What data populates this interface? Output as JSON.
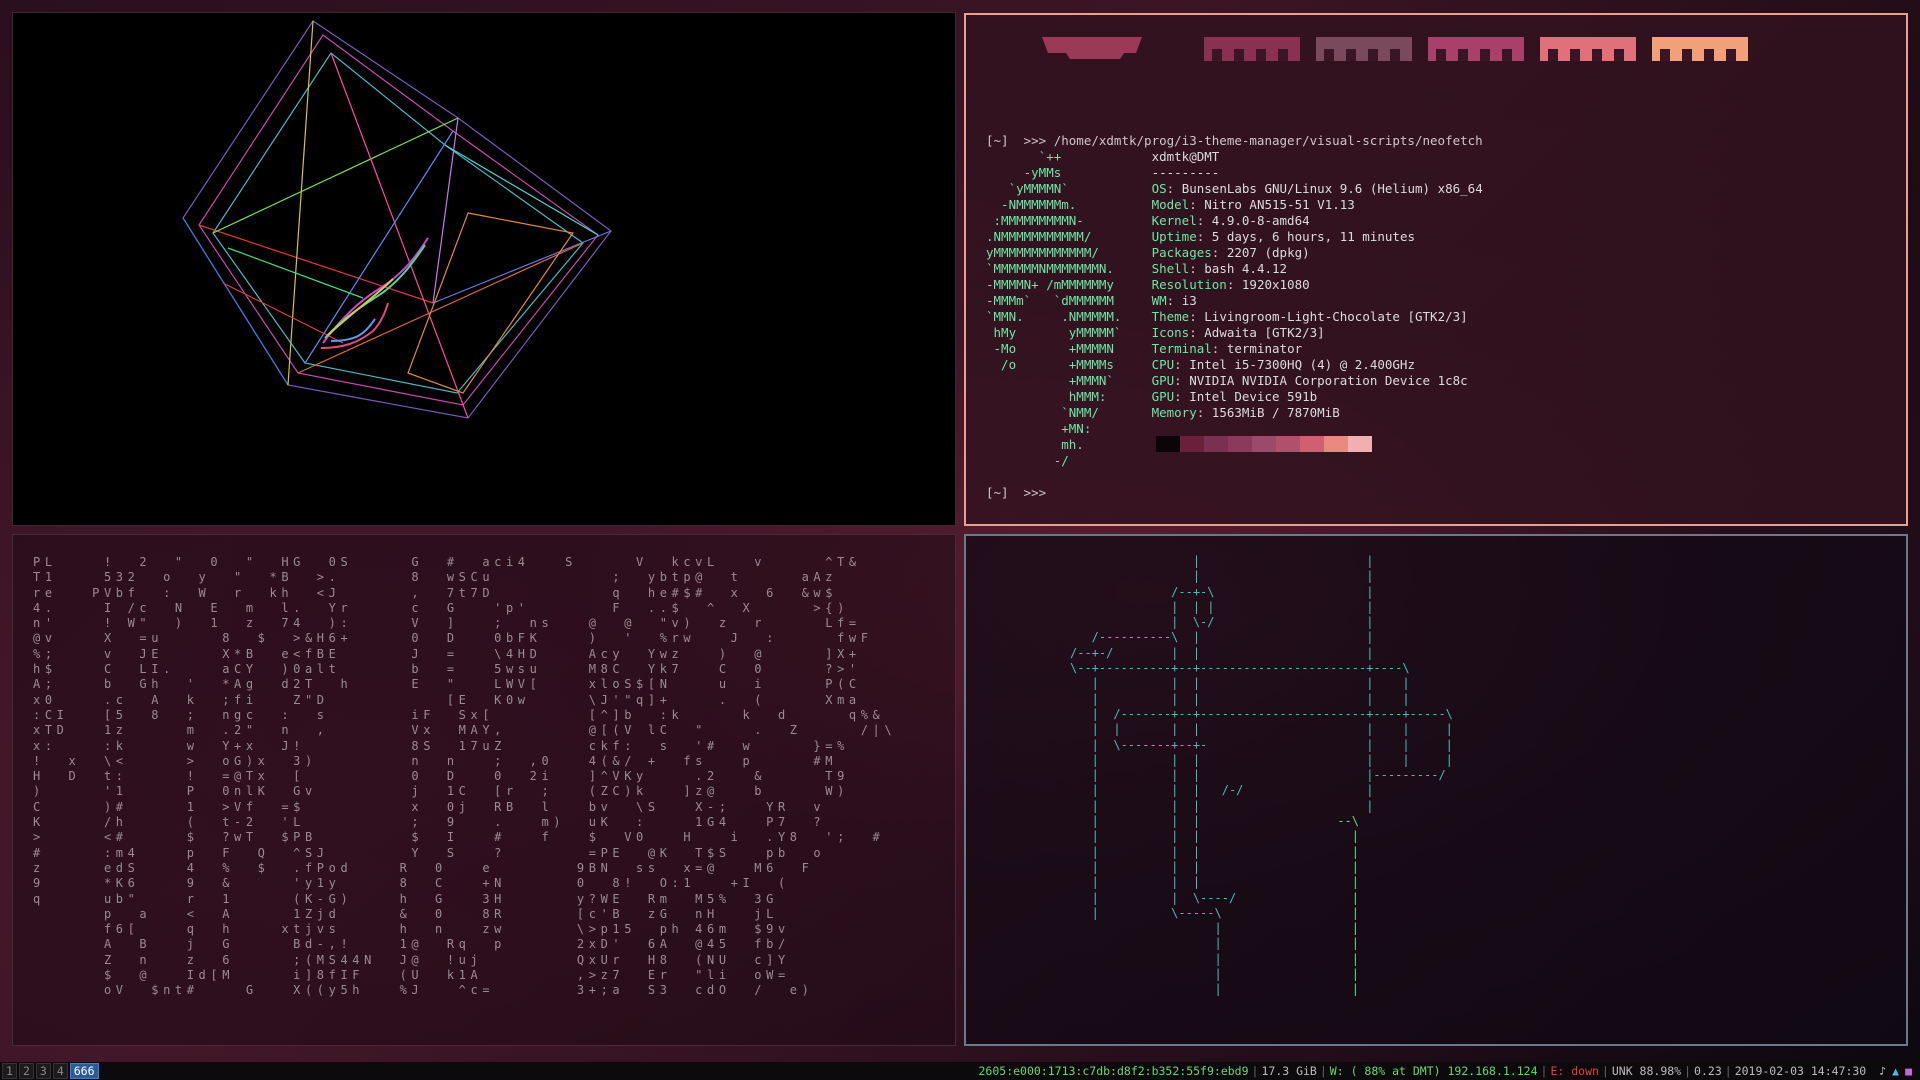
{
  "workspaces": [
    {
      "label": "1",
      "active": false
    },
    {
      "label": "2",
      "active": false
    },
    {
      "label": "3",
      "active": false
    },
    {
      "label": "4",
      "active": false
    },
    {
      "label": "666",
      "active": true
    }
  ],
  "neofetch": {
    "prompt_cmd": "[~]  >>> /home/xdmtk/prog/i3-theme-manager/visual-scripts/neofetch",
    "userhost": "xdmtk@DMT",
    "divider": "---------",
    "fields": [
      {
        "key": "OS",
        "value": "BunsenLabs GNU/Linux 9.6 (Helium) x86_64"
      },
      {
        "key": "Model",
        "value": "Nitro AN515-51 V1.13"
      },
      {
        "key": "Kernel",
        "value": "4.9.0-8-amd64"
      },
      {
        "key": "Uptime",
        "value": "5 days, 6 hours, 11 minutes"
      },
      {
        "key": "Packages",
        "value": "2207 (dpkg)"
      },
      {
        "key": "Shell",
        "value": "bash 4.4.12"
      },
      {
        "key": "Resolution",
        "value": "1920x1080"
      },
      {
        "key": "WM",
        "value": "i3"
      },
      {
        "key": "Theme",
        "value": "Livingroom-Light-Chocolate [GTK2/3]"
      },
      {
        "key": "Icons",
        "value": "Adwaita [GTK2/3]"
      },
      {
        "key": "Terminal",
        "value": "terminator"
      },
      {
        "key": "CPU",
        "value": "Intel i5-7300HQ (4) @ 2.400GHz"
      },
      {
        "key": "GPU",
        "value": "NVIDIA NVIDIA Corporation Device 1c8c"
      },
      {
        "key": "GPU",
        "value": "Intel Device 591b"
      },
      {
        "key": "Memory",
        "value": "1563MiB / 7870MiB"
      }
    ],
    "logo": [
      "       `++",
      "     -yMMs",
      "   `yMMMMN`",
      "  -NMMMMMMm.",
      " :MMMMMMMMMN-",
      ".NMMMMMMMMMMM/",
      "yMMMMMMMMMMMMM/",
      "`MMMMMMNMMMMMMMN.",
      "-MMMMN+ /mMMMMMMy",
      "-MMMm`   `dMMMMMM",
      "`MMN.     .NMMMMM.",
      " hMy       yMMMMM`",
      " -Mo       +MMMMN",
      "  /o       +MMMMs",
      "           +MMMN`",
      "           hMMM:",
      "          `NMM/",
      "          +MN:",
      "          mh.",
      "         -/"
    ],
    "prompt_end": "[~]  >>>",
    "palette": [
      "#0b0508",
      "#6a1f3b",
      "#7a3050",
      "#8c3a5c",
      "#9c4a6a",
      "#b0506a",
      "#d06070",
      "#e88a80",
      "#f0b0b0"
    ],
    "header_blocks": [
      "#9a3a58",
      "#8a3050",
      "#7a4a5c",
      "#a8406a",
      "#e0707a",
      "#f2a07a"
    ]
  },
  "matrix_lines": [
    "PL    !  2  \"  0  \"  HG  0S     G  #  aci4   S     V  kcvL   v     ^T&",
    "T1    532  o  y  \"  *B  >.      8  wSCu          ;  ybtp@  t     aAz",
    "re   PVbf  :  W  r  kh  <J      ,  7t7D          q  he#$#  x  6  &w$",
    "4.    I /c  N  E  m  l.  Yr     c  G   'p'       F  ..$  ^  X     >{)",
    "n'    ! W\"  )  1  z  74  ):     V  ]   ;  ns   @  @  \"v)  z  r     Lf=",
    "@v    X  =u     8  $  >&H6+     0  D   0bFK    )  '  %rw   J  :     fwF",
    "%;    v  JE     X*B  e<fBE      J  =   \\4HD    Acy  Ywz   )  @     ]X+",
    "h$    C  LI.    aCY  )0alt      b  =   5wsu    M8C  Yk7   C  0     ?>'",
    "A;    b  Gh  '  *Ag  d2T  h     E  \"   LWV[    xloS$[N    u  i     P(C",
    "x0    .c  A  k  ;fi   Z\"D          [E  K0w     \\J'\"q]+    .  (     Xma",
    ":CI   [5  8  ;  ngc  :  s       iF  Sx[        [^]b  :k     k  d     q%&",
    "xTD   1z     m  .2\"  n  ,       Vx  MAY,       @[(V lC  \"    .  Z     /|\\",
    "x:    :k     w  Y+x  J!         8S  17uZ       ckf:  s  '#  w     }=%",
    "!  x  \\<     >  oG)x  3)        n  n   ;  ,0   4(&/ +  fs   p     #M",
    "H  D  t:     !  =@Tx  [         0  D   0  2i   ]^VKy    .2   &     T9",
    ")     '1     P  0nlK  Gv        j  1C  [r  ;   (ZC)k   ]z@   b     W)",
    "C     )#     1  >Vf  =$         x  0j  RB  l   bv  \\S   X-;   YR  v",
    "K     /h     (  t-2  'L         ;  9   .   m)  uK  :    1G4   P7  ?",
    ">     <#     $  ?wT  $PB        $  I   #   f   $  V0   H   i  .Y8  ';  #",
    "#     :m4    p  F  Q  ^SJ       Y  S   ?       =PE  @K  T$S   pb  o",
    "z     edS    4  %  $  .fPod    R  0   e       9BN  ss  x=@   M6  F",
    "9     *K6    9  &     'y1y     8  C   +N      0  8!  O:1   +I  (",
    "q     ub\"    r  1     (K-G)    h  G   3H      y?WE  Rm  M5%  3G",
    "      p  a   <  A     1Zjd     &  0   8R      [c'B  zG  nH   jL",
    "      f6[    q  h    xtjvs     h  n   zw      \\>p15  ph 46m  $9v",
    "      A  B   j  G     Bd-,!    1@  Rq  p      2xD'  6A  @45  fb/",
    "      Z  n   z  6     ;(MS44N  J@  !uj        QxUr  H8  (NU  c]Y",
    "      $  @   Id[M     i]8fIF   (U  k1A        ,>z7  Er  \"li  oW=",
    "      oV  $nt#    G   X((y5h   %J   ^c=       3+;a  S3  cdO  /  e)"
  ],
  "status": {
    "ipv6": "2605:e000:1713:c7db:d8f2:b352:55f9:ebd9",
    "disk": "17.3 GiB",
    "wifi": "W: ( 88% at DMT) 192.168.1.124",
    "eth": "E: down",
    "battery": "UNK 88.98%",
    "load": "0.23",
    "datetime": "2019-02-03 14:47:30",
    "wifi_color": "#6ad66a",
    "eth_color": "#e04040",
    "ipv6_color": "#6ad66a"
  }
}
